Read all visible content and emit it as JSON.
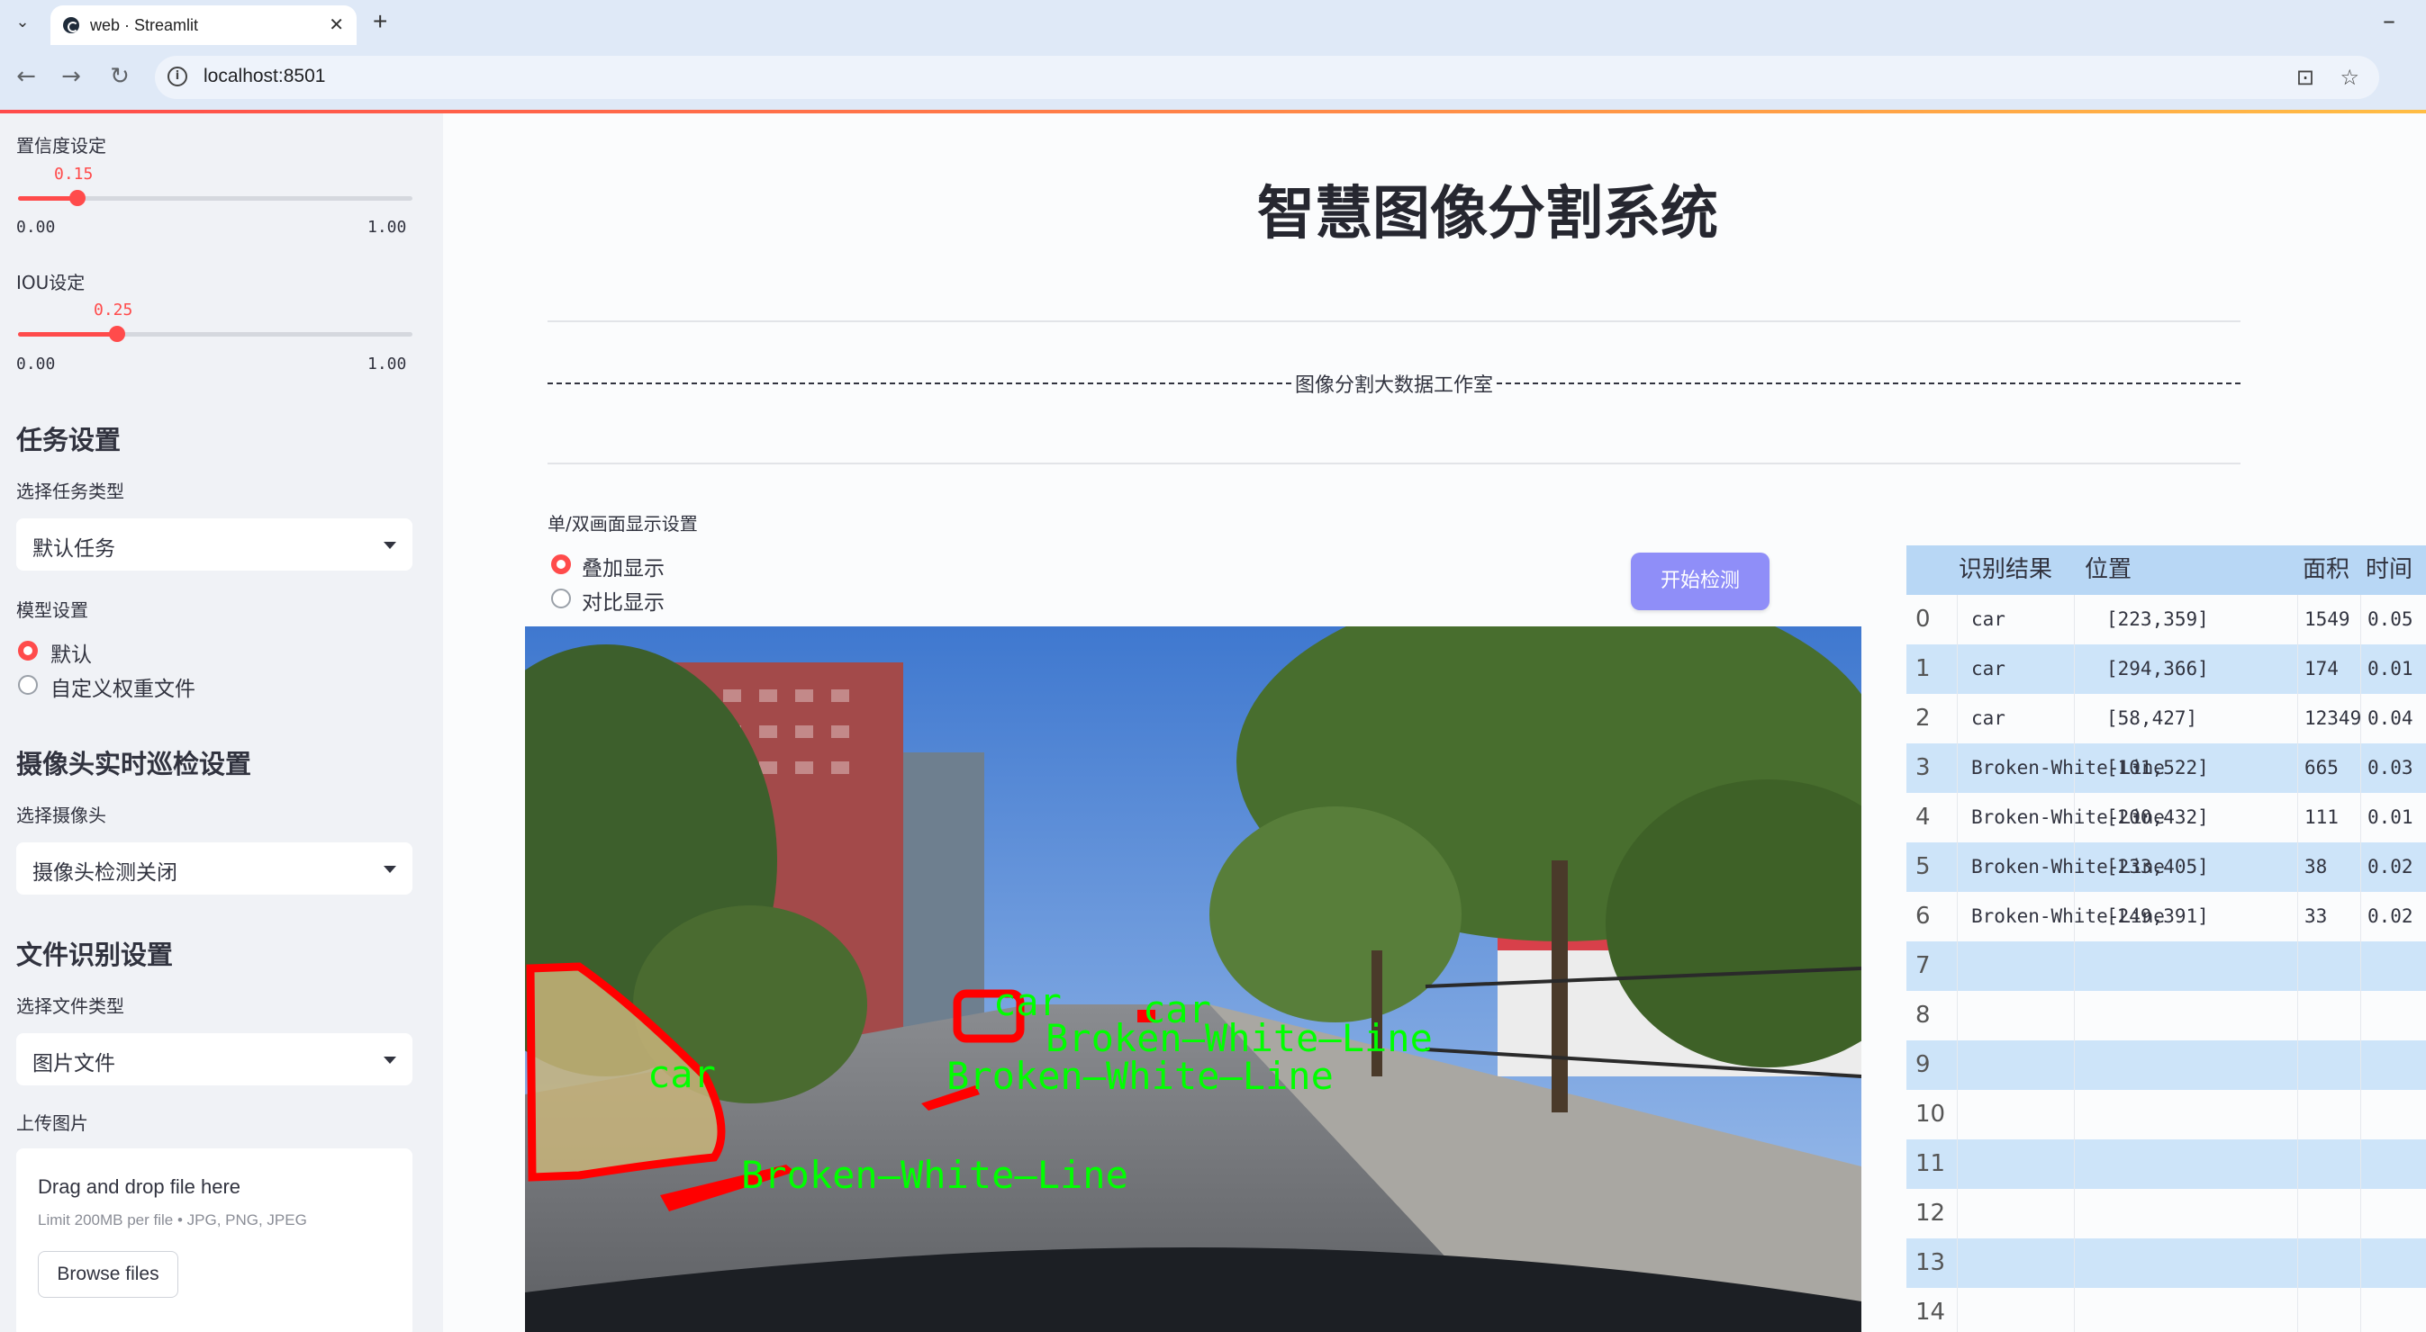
{
  "browser": {
    "tab_title": "web · Streamlit",
    "url": "localhost:8501"
  },
  "sidebar": {
    "confidence": {
      "label": "置信度设定",
      "value": "0.15",
      "min": "0.00",
      "max": "1.00",
      "fraction": 0.15
    },
    "iou": {
      "label": "IOU设定",
      "value": "0.25",
      "min": "0.00",
      "max": "1.00",
      "fraction": 0.25
    },
    "task_header": "任务设置",
    "task_type_label": "选择任务类型",
    "task_type_value": "默认任务",
    "model_label": "模型设置",
    "model_options": [
      "默认",
      "自定义权重文件"
    ],
    "model_selected": "默认",
    "camera_header": "摄像头实时巡检设置",
    "camera_label": "选择摄像头",
    "camera_value": "摄像头检测关闭",
    "file_header": "文件识别设置",
    "file_type_label": "选择文件类型",
    "file_type_value": "图片文件",
    "upload_label": "上传图片",
    "upload_title": "Drag and drop file here",
    "upload_limit": "Limit 200MB per file • JPG, PNG, JPEG",
    "browse_label": "Browse files"
  },
  "main": {
    "title": "智慧图像分割系统",
    "studio": "图像分割大数据工作室",
    "display_label": "单/双画面显示设置",
    "display_options": [
      "叠加显示",
      "对比显示"
    ],
    "display_selected": "叠加显示",
    "start_button": "开始检测"
  },
  "detections": [
    {
      "label": "car",
      "text": "car"
    },
    {
      "label": "car",
      "text": "car"
    },
    {
      "label": "car",
      "text": "car"
    },
    {
      "label": "Broken-White-Line",
      "text": "Broken—White—Line"
    },
    {
      "label": "Broken-White-Line",
      "text": "Broken—White—Line"
    },
    {
      "label": "Broken-White-Line",
      "text": "Broken—White—Line"
    }
  ],
  "table": {
    "headers": [
      "识别结果",
      "位置",
      "面积",
      "时间"
    ],
    "rows": [
      {
        "idx": "0",
        "result": "car",
        "pos": "[223,359]",
        "area": "1549",
        "time": "0.05"
      },
      {
        "idx": "1",
        "result": "car",
        "pos": "[294,366]",
        "area": "174",
        "time": "0.01"
      },
      {
        "idx": "2",
        "result": "car",
        "pos": "[58,427]",
        "area": "12349",
        "time": "0.04"
      },
      {
        "idx": "3",
        "result": "Broken-White-Line",
        "pos": "[101,522]",
        "area": "665",
        "time": "0.03"
      },
      {
        "idx": "4",
        "result": "Broken-White-Line",
        "pos": "[200,432]",
        "area": "111",
        "time": "0.01"
      },
      {
        "idx": "5",
        "result": "Broken-White-Line",
        "pos": "[233,405]",
        "area": "38",
        "time": "0.02"
      },
      {
        "idx": "6",
        "result": "Broken-White-Line",
        "pos": "[249,391]",
        "area": "33",
        "time": "0.02"
      },
      {
        "idx": "7",
        "result": "",
        "pos": "",
        "area": "",
        "time": ""
      },
      {
        "idx": "8",
        "result": "",
        "pos": "",
        "area": "",
        "time": ""
      },
      {
        "idx": "9",
        "result": "",
        "pos": "",
        "area": "",
        "time": ""
      },
      {
        "idx": "10",
        "result": "",
        "pos": "",
        "area": "",
        "time": ""
      },
      {
        "idx": "11",
        "result": "",
        "pos": "",
        "area": "",
        "time": ""
      },
      {
        "idx": "12",
        "result": "",
        "pos": "",
        "area": "",
        "time": ""
      },
      {
        "idx": "13",
        "result": "",
        "pos": "",
        "area": "",
        "time": ""
      },
      {
        "idx": "14",
        "result": "",
        "pos": "",
        "area": "",
        "time": ""
      }
    ]
  },
  "colors": {
    "accent": "#ff4b4b",
    "button": "#8f8ef8",
    "mask_outline": "#ff0000",
    "label_green": "#00ff00",
    "table_header": "#b8d7f5",
    "table_alt": "#cde4f9"
  }
}
